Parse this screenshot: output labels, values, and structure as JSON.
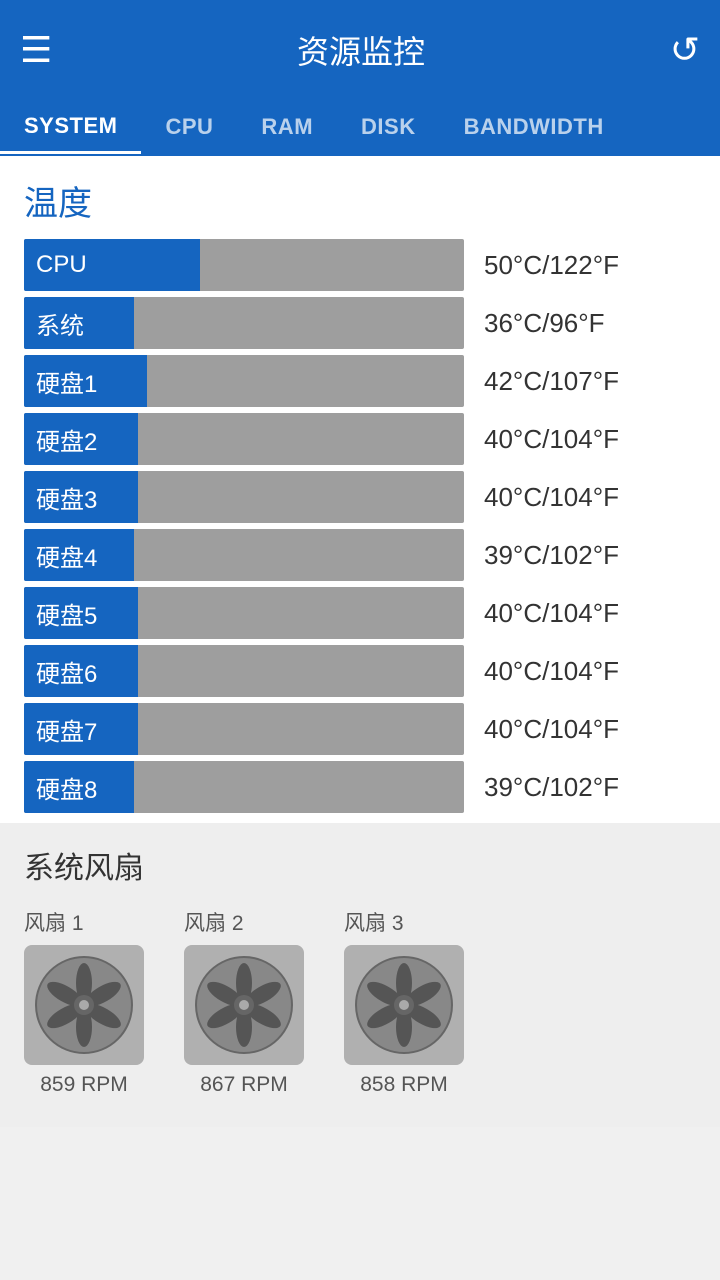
{
  "header": {
    "title": "资源监控",
    "menu_icon": "☰",
    "refresh_icon": "↺"
  },
  "tabs": [
    {
      "label": "SYSTEM",
      "active": true
    },
    {
      "label": "CPU",
      "active": false
    },
    {
      "label": "RAM",
      "active": false
    },
    {
      "label": "DISK",
      "active": false
    },
    {
      "label": "BANDWIDTH",
      "active": false
    }
  ],
  "temperature": {
    "section_title": "温度",
    "rows": [
      {
        "label": "CPU",
        "value": "50°C/122°F",
        "fill_pct": 40
      },
      {
        "label": "系统",
        "value": "36°C/96°F",
        "fill_pct": 25
      },
      {
        "label": "硬盘1",
        "value": "42°C/107°F",
        "fill_pct": 28
      },
      {
        "label": "硬盘2",
        "value": "40°C/104°F",
        "fill_pct": 26
      },
      {
        "label": "硬盘3",
        "value": "40°C/104°F",
        "fill_pct": 26
      },
      {
        "label": "硬盘4",
        "value": "39°C/102°F",
        "fill_pct": 25
      },
      {
        "label": "硬盘5",
        "value": "40°C/104°F",
        "fill_pct": 26
      },
      {
        "label": "硬盘6",
        "value": "40°C/104°F",
        "fill_pct": 26
      },
      {
        "label": "硬盘7",
        "value": "40°C/104°F",
        "fill_pct": 26
      },
      {
        "label": "硬盘8",
        "value": "39°C/102°F",
        "fill_pct": 25
      }
    ]
  },
  "fans": {
    "section_title": "系统风扇",
    "items": [
      {
        "label": "风扇 1",
        "rpm": "859 RPM"
      },
      {
        "label": "风扇 2",
        "rpm": "867 RPM"
      },
      {
        "label": "风扇 3",
        "rpm": "858 RPM"
      }
    ]
  }
}
